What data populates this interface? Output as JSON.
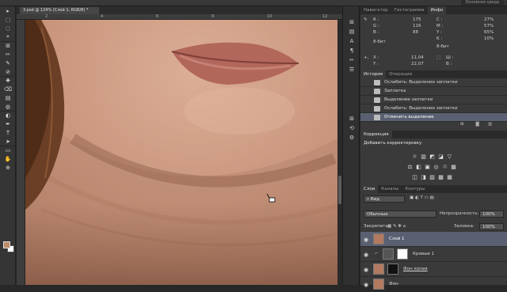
{
  "app": {
    "badge": "Основная среда"
  },
  "document": {
    "tab_title": "3.psd @ 124% (Слой 1, RGB/8) *"
  },
  "ruler": {
    "ticks": [
      "2",
      "4",
      "6",
      "8",
      "10",
      "12"
    ]
  },
  "tools": [
    "▸",
    "⬚",
    "◌",
    "⌖",
    "⊞",
    "✂",
    "✎",
    "⊘",
    "✚",
    "⌫",
    "▤",
    "◍",
    "◐",
    "✒",
    "T",
    "➤",
    "▭",
    "✋",
    "⊕"
  ],
  "strip_icons": [
    "⊞",
    "▤",
    "A",
    "¶",
    "✂",
    "☰",
    "⊞",
    "⟲",
    "⚙"
  ],
  "info_panel": {
    "tabs": [
      "Навигатор",
      "Гистограмма",
      "Инфо"
    ],
    "rgb": {
      "R": "175",
      "G": "116",
      "B": "88"
    },
    "cmyk": {
      "C": "27%",
      "M": "57%",
      "Y": "65%",
      "K": "10%"
    },
    "bitdepth_left": "8-бит",
    "bitdepth_right": "8-бит",
    "coords": {
      "X": "11,04",
      "Y": "22,07"
    },
    "size": {
      "W": "",
      "H": ""
    }
  },
  "history_panel": {
    "tabs": [
      "История",
      "Операции"
    ],
    "items": [
      {
        "label": "Ослабить: Выделение заплатки",
        "selected": false
      },
      {
        "label": "Заплатка",
        "selected": false
      },
      {
        "label": "Выделение заплатки",
        "selected": false
      },
      {
        "label": "Ослабить: Выделение заплатки",
        "selected": false
      },
      {
        "label": "Отменить выделение",
        "selected": true
      }
    ]
  },
  "corrections_panel": {
    "tabs": [
      "Коррекция"
    ],
    "title": "Добавить корректировку",
    "row1": [
      "☼",
      "▥",
      "◩",
      "◪",
      "▽"
    ],
    "row2": [
      "⚖",
      "◧",
      "▣",
      "◎",
      "♲",
      "▦"
    ],
    "row3": [
      "◫",
      "◨",
      "▨",
      "▩",
      "▦"
    ]
  },
  "layers_panel": {
    "tabs": [
      "Слои",
      "Каналы",
      "Контуры"
    ],
    "kind_label": "Вид",
    "blend_mode": "Обычные",
    "opacity_label": "Непрозрачность:",
    "opacity_value": "100%",
    "lock_label": "Закрепить:",
    "fill_label": "Заливка:",
    "fill_value": "100%",
    "layers": [
      {
        "name": "Слой 1",
        "selected": true,
        "type": "photo"
      },
      {
        "name": "Кривые 1",
        "selected": false,
        "type": "adjustment"
      },
      {
        "name": "Фон копия",
        "selected": false,
        "type": "masked"
      },
      {
        "name": "Фон",
        "selected": false,
        "type": "photo"
      }
    ]
  },
  "colors": {
    "selection": "#5a6071",
    "panel": "#3a3a3a",
    "foreground": "#bd8a68",
    "background": "#ffffff"
  }
}
